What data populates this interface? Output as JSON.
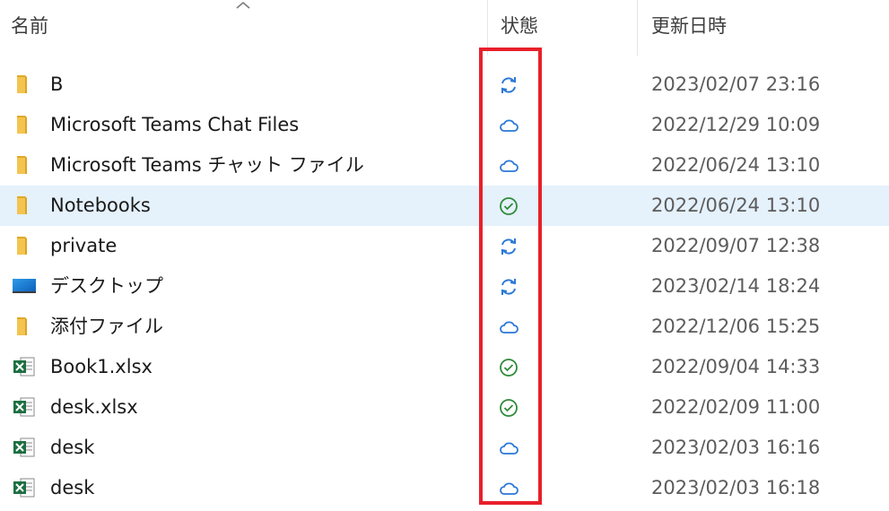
{
  "header": {
    "name_label": "名前",
    "status_label": "状態",
    "date_label": "更新日時"
  },
  "colors": {
    "folder": "#f3c44f",
    "sync_blue": "#2b78d6",
    "synced_green": "#2e8b3a",
    "excel_green": "#1d6f42",
    "selected_row": "#e5f1fb",
    "highlight_red": "#e8202a"
  },
  "files": [
    {
      "name": "B",
      "type": "folder-icon",
      "status": "sync-icon",
      "date": "2023/02/07 23:16"
    },
    {
      "name": "Microsoft Teams Chat Files",
      "type": "folder-icon",
      "status": "cloud-icon",
      "date": "2022/12/29 10:09"
    },
    {
      "name": "Microsoft Teams チャット ファイル",
      "type": "folder-icon",
      "status": "cloud-icon",
      "date": "2022/06/24 13:10"
    },
    {
      "name": "Notebooks",
      "type": "folder-icon",
      "status": "check-circle-icon",
      "date": "2022/06/24 13:10",
      "selected": true
    },
    {
      "name": "private",
      "type": "folder-icon",
      "status": "sync-icon",
      "date": "2022/09/07 12:38"
    },
    {
      "name": "デスクトップ",
      "type": "desktop-icon",
      "status": "sync-icon",
      "date": "2023/02/14 18:24"
    },
    {
      "name": "添付ファイル",
      "type": "folder-icon",
      "status": "cloud-icon",
      "date": "2022/12/06 15:25"
    },
    {
      "name": "Book1.xlsx",
      "type": "excel-icon",
      "status": "check-circle-icon",
      "date": "2022/09/04 14:33"
    },
    {
      "name": "desk.xlsx",
      "type": "excel-icon",
      "status": "check-circle-icon",
      "date": "2022/02/09 11:00"
    },
    {
      "name": "desk",
      "type": "excel-icon",
      "status": "cloud-icon",
      "date": "2023/02/03 16:16"
    },
    {
      "name": "desk",
      "type": "excel-icon",
      "status": "cloud-icon",
      "date": "2023/02/03 16:18"
    }
  ]
}
